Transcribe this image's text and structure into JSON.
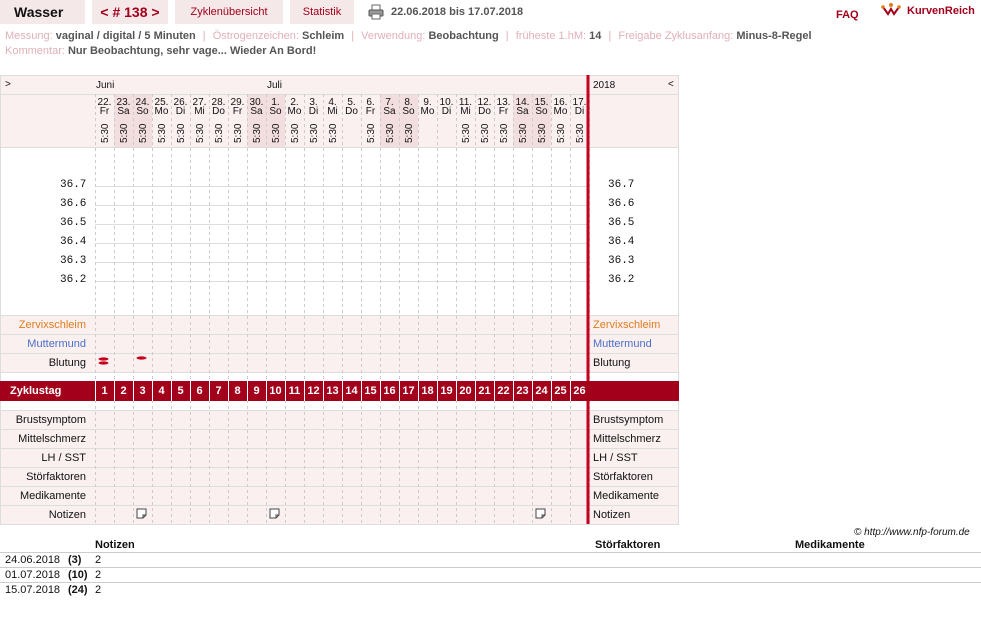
{
  "header": {
    "user": "Wasser",
    "cycle_label": "< # 138 >",
    "overview": "Zyklenübersicht",
    "statistics": "Statistik",
    "date_range": "22.06.2018 bis 17.07.2018",
    "faq": "FAQ",
    "logo": "KurvenReich"
  },
  "info": {
    "messung_label": "Messung:",
    "messung": "vaginal / digital / 5 Minuten",
    "oestrogen_label": "Östrogenzeichen:",
    "oestrogen": "Schleim",
    "verwendung_label": "Verwendung:",
    "verwendung": "Beobachtung",
    "frueheste_label": "früheste 1.hM:",
    "frueheste": "14",
    "freigabe_label": "Freigabe Zyklusanfang:",
    "freigabe": "Minus-8-Regel",
    "kommentar_label": "Kommentar:",
    "kommentar": "Nur Beobachtung, sehr vage... Wieder An Bord!"
  },
  "chart": {
    "nav_prev": ">",
    "nav_next": "<",
    "year": "2018",
    "month_june": "Juni",
    "month_july": "Juli",
    "time": "5:30",
    "temps": [
      "36.7",
      "36.6",
      "36.5",
      "36.4",
      "36.3",
      "36.2"
    ],
    "rows_top": [
      "Zervixschleim",
      "Muttermund",
      "Blutung"
    ],
    "cycle_label": "Zyklustag",
    "rows_bottom": [
      "Brustsymptom",
      "Mittelschmerz",
      "LH / SST",
      "Störfaktoren",
      "Medikamente",
      "Notizen"
    ]
  },
  "chart_data": {
    "type": "table",
    "days": [
      {
        "date": "22.",
        "wd": "Fr",
        "weekend": false
      },
      {
        "date": "23.",
        "wd": "Sa",
        "weekend": true
      },
      {
        "date": "24.",
        "wd": "So",
        "weekend": true
      },
      {
        "date": "25.",
        "wd": "Mo",
        "weekend": false
      },
      {
        "date": "26.",
        "wd": "Di",
        "weekend": false
      },
      {
        "date": "27.",
        "wd": "Mi",
        "weekend": false
      },
      {
        "date": "28.",
        "wd": "Do",
        "weekend": false
      },
      {
        "date": "29.",
        "wd": "Fr",
        "weekend": false
      },
      {
        "date": "30.",
        "wd": "Sa",
        "weekend": true
      },
      {
        "date": "1.",
        "wd": "So",
        "weekend": true
      },
      {
        "date": "2.",
        "wd": "Mo",
        "weekend": false
      },
      {
        "date": "3.",
        "wd": "Di",
        "weekend": false
      },
      {
        "date": "4.",
        "wd": "Mi",
        "weekend": false
      },
      {
        "date": "5.",
        "wd": "Do",
        "weekend": false
      },
      {
        "date": "6.",
        "wd": "Fr",
        "weekend": false
      },
      {
        "date": "7.",
        "wd": "Sa",
        "weekend": true
      },
      {
        "date": "8.",
        "wd": "So",
        "weekend": true
      },
      {
        "date": "9.",
        "wd": "Mo",
        "weekend": false
      },
      {
        "date": "10.",
        "wd": "Di",
        "weekend": false
      },
      {
        "date": "11.",
        "wd": "Mi",
        "weekend": false
      },
      {
        "date": "12.",
        "wd": "Do",
        "weekend": false
      },
      {
        "date": "13.",
        "wd": "Fr",
        "weekend": false
      },
      {
        "date": "14.",
        "wd": "Sa",
        "weekend": true
      },
      {
        "date": "15.",
        "wd": "So",
        "weekend": true
      },
      {
        "date": "16.",
        "wd": "Mo",
        "weekend": false
      },
      {
        "date": "17.",
        "wd": "Di",
        "weekend": false
      }
    ],
    "time_shown_days": [
      1,
      2,
      3,
      4,
      5,
      6,
      7,
      8,
      9,
      10,
      11,
      12,
      13,
      15,
      16,
      17,
      20,
      21,
      22,
      23,
      24,
      25,
      26
    ],
    "cycle_days": [
      1,
      2,
      3,
      4,
      5,
      6,
      7,
      8,
      9,
      10,
      11,
      12,
      13,
      14,
      15,
      16,
      17,
      18,
      19,
      20,
      21,
      22,
      23,
      24,
      25,
      26
    ],
    "bleeding": [
      {
        "day": 1,
        "level": "stark"
      },
      {
        "day": 3,
        "level": "leicht"
      }
    ],
    "notes_days": [
      3,
      10,
      24
    ]
  },
  "notes": {
    "col_notes": "Notizen",
    "col_stoer": "Störfaktoren",
    "col_med": "Medikamente",
    "rows": [
      {
        "date": "24.06.2018",
        "day": "(3)",
        "note": "2"
      },
      {
        "date": "01.07.2018",
        "day": "(10)",
        "note": "2"
      },
      {
        "date": "15.07.2018",
        "day": "(24)",
        "note": "2"
      }
    ]
  },
  "copyright": "© http://www.nfp-forum.de"
}
